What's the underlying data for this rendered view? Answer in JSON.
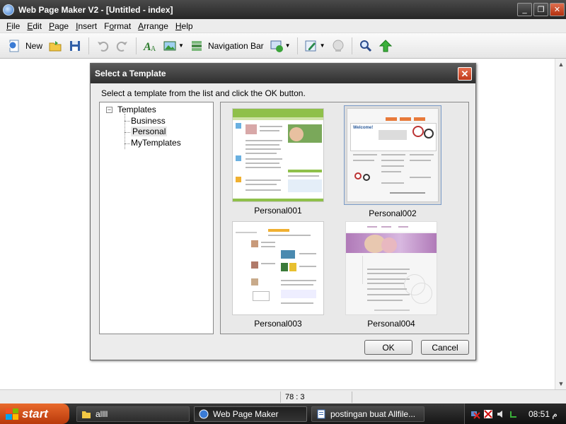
{
  "window": {
    "title": "Web Page Maker V2 - [Untitled - index]",
    "controls": [
      "_",
      "❐",
      "✕"
    ]
  },
  "menu": [
    "File",
    "Edit",
    "Page",
    "Insert",
    "Format",
    "Arrange",
    "Help"
  ],
  "menu_underline": [
    "F",
    "E",
    "P",
    "I",
    "o",
    "A",
    "H"
  ],
  "toolbar": {
    "new_label": "New",
    "navbar_label": "Navigation Bar"
  },
  "dialog": {
    "title": "Select a Template",
    "close": "✕",
    "instruction": "Select a template from the list and click the OK button.",
    "tree": {
      "root": "Templates",
      "expander": "−",
      "children": [
        "Business",
        "Personal",
        "MyTemplates"
      ],
      "selected": "Personal"
    },
    "templates": [
      {
        "name": "Personal001",
        "selected": false
      },
      {
        "name": "Personal002",
        "selected": true
      },
      {
        "name": "Personal003",
        "selected": false
      },
      {
        "name": "Personal004",
        "selected": false
      }
    ],
    "thumb_texts": {
      "p002_welcome": "Welcome!"
    },
    "ok": "OK",
    "cancel": "Cancel"
  },
  "statusbar": {
    "coordinates": "78 : 3"
  },
  "taskbar": {
    "start": "start",
    "tasks": [
      "allll",
      "Web Page Maker",
      "postingan buat Allfile..."
    ],
    "clock": "08:51",
    "clock_suffix": "م"
  },
  "colors": {
    "title_bg": "#2f2f2f",
    "start_orange": "#d9531a",
    "selection_border": "#7a9bc8"
  }
}
